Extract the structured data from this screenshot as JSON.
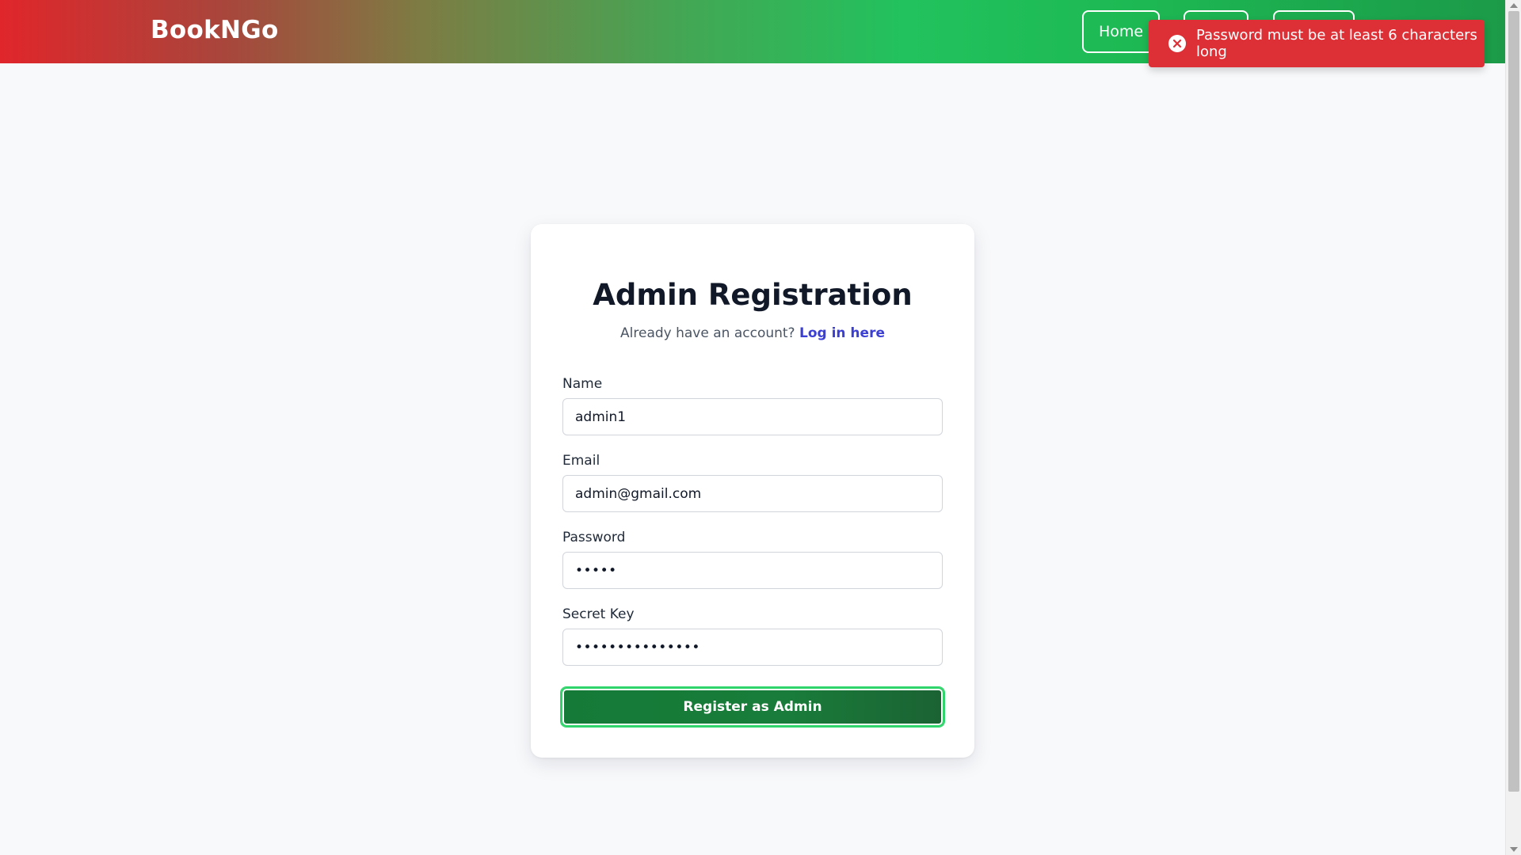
{
  "header": {
    "brand": "BookNGo",
    "nav": {
      "home_label": "Home",
      "item2_label": "",
      "item3_label": ""
    }
  },
  "toast": {
    "icon": "error-x-icon",
    "message": "Password must be at least 6 characters long",
    "color": "#dc2f36"
  },
  "form": {
    "title": "Admin Registration",
    "subtitle_prefix": "Already have an account?",
    "login_link": "Log in here",
    "name": {
      "label": "Name",
      "value": "admin1"
    },
    "email": {
      "label": "Email",
      "value": "admin@gmail.com"
    },
    "password": {
      "label": "Password",
      "value": "•••••"
    },
    "secret_key": {
      "label": "Secret Key",
      "value": "•••••••••••••••"
    },
    "submit_label": "Register as Admin"
  },
  "colors": {
    "accent_green": "#197c3a",
    "link_blue": "#3b3fd4",
    "error_red": "#dc2f36"
  }
}
